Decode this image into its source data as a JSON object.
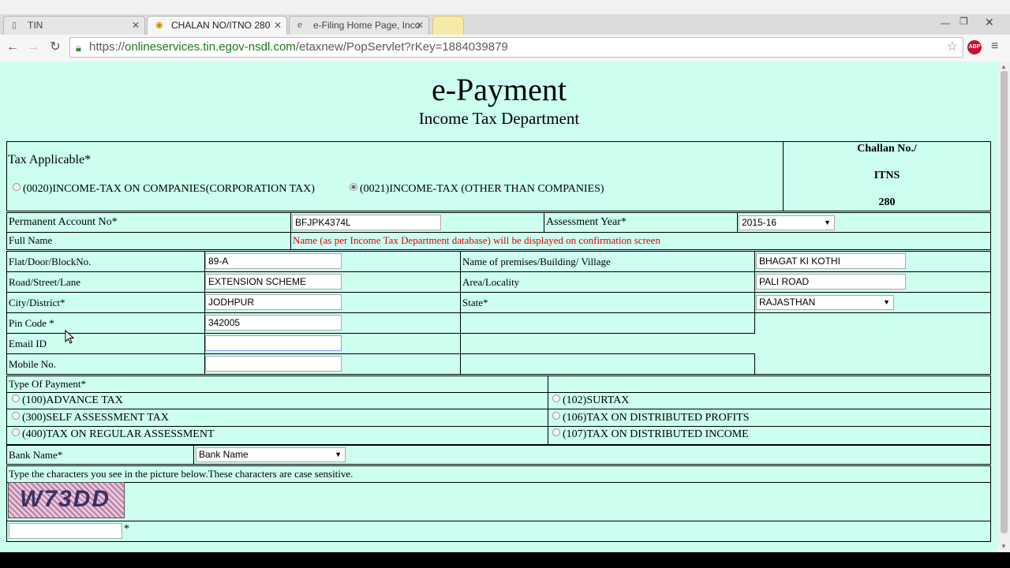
{
  "browser": {
    "tabs": [
      {
        "label": "TIN"
      },
      {
        "label": "CHALAN NO/ITNO 280"
      },
      {
        "label": "e-Filing Home Page, Inco"
      }
    ],
    "url_scheme": "https://",
    "url_host": "onlineservices.tin.egov-nsdl.com",
    "url_path": "/etaxnew/PopServlet?rKey=1884039879",
    "abp_label": "ABP"
  },
  "header": {
    "title": "e-Payment",
    "subtitle": "Income Tax Department"
  },
  "tax": {
    "label": "Tax Applicable*",
    "option1": "(0020)INCOME-TAX ON COMPANIES(CORPORATION TAX)",
    "option2": "(0021)INCOME-TAX (OTHER THAN COMPANIES)",
    "challan_line1": "Challan No./",
    "challan_line2": "ITNS",
    "challan_line3": "280"
  },
  "form": {
    "pan_label": "Permanent Account No*",
    "pan_value": "BFJPK4374L",
    "ay_label": "Assessment Year*",
    "ay_value": "2015-16",
    "fullname_label": "Full Name",
    "fullname_note": "Name (as per Income Tax Department database) will be displayed on confirmation screen",
    "flat_label": "Flat/Door/BlockNo.",
    "flat_value": "89-A",
    "premises_label": "Name of premises/Building/ Village",
    "premises_value": "BHAGAT KI KOTHI",
    "road_label": "Road/Street/Lane",
    "road_value": "EXTENSION SCHEME",
    "area_label": "Area/Locality",
    "area_value": "PALI ROAD",
    "city_label": "City/District*",
    "city_value": "JODHPUR",
    "state_label": "State*",
    "state_value": "RAJASTHAN",
    "pin_label": "Pin Code *",
    "pin_value": "342005",
    "email_label": "Email ID",
    "email_value": "",
    "mobile_label": "Mobile No.",
    "mobile_value": ""
  },
  "payment": {
    "label": "Type Of Payment*",
    "opt100": "(100)ADVANCE TAX",
    "opt102": "(102)SURTAX",
    "opt300": "(300)SELF ASSESSMENT TAX",
    "opt106": "(106)TAX ON DISTRIBUTED PROFITS",
    "opt400": "(400)TAX ON REGULAR ASSESSMENT",
    "opt107": "(107)TAX ON DISTRIBUTED INCOME"
  },
  "bank": {
    "label": "Bank Name*",
    "value": "Bank Name"
  },
  "captcha": {
    "instruction": "Type the characters you see in the picture below.These characters are case sensitive.",
    "image_text": "W73DD",
    "input_value": "",
    "required_mark": "*"
  }
}
